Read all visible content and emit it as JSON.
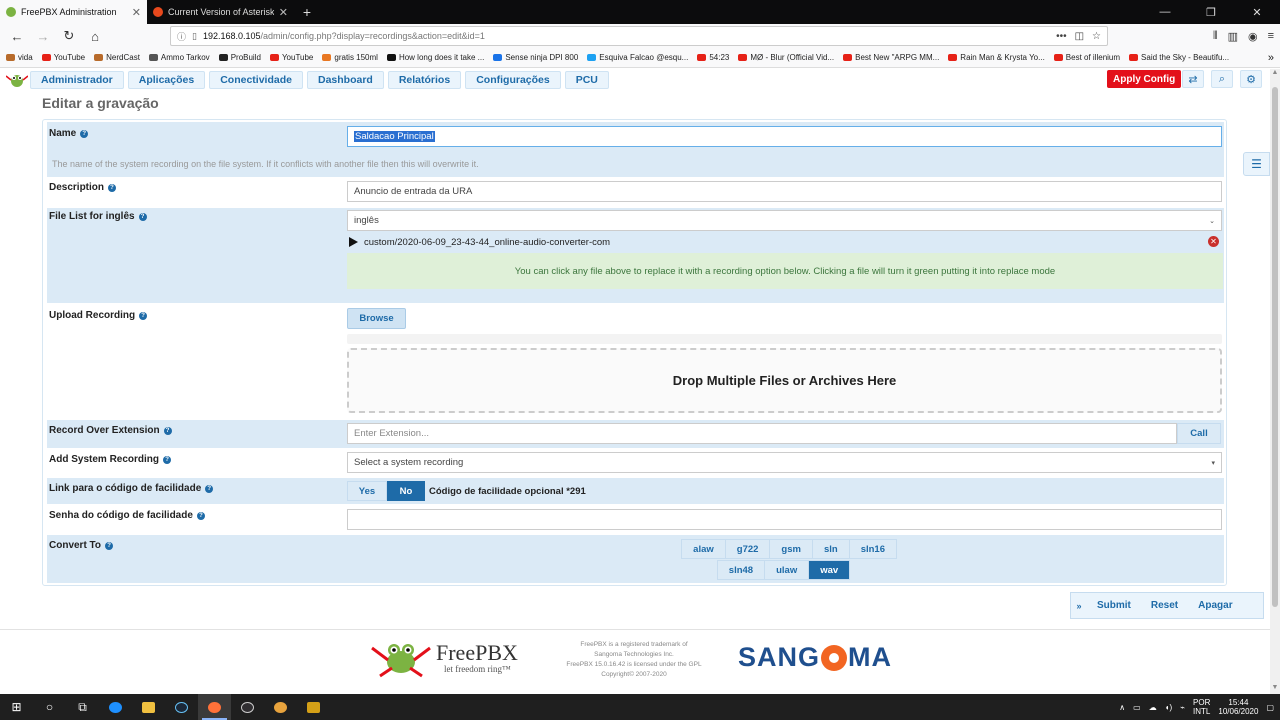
{
  "browser": {
    "tabs": [
      {
        "label": "FreePBX Administration",
        "active": true
      },
      {
        "label": "Current Version of Asterisk and",
        "active": false
      }
    ],
    "url_host": "192.168.0.105",
    "url_path": "/admin/config.php?display=recordings&action=edit&id=1",
    "bookmarks": [
      {
        "label": "vida",
        "color": "#b86b2b"
      },
      {
        "label": "YouTube",
        "color": "#e62117"
      },
      {
        "label": "NerdCast",
        "color": "#b86b2b"
      },
      {
        "label": "Ammo Tarkov",
        "color": "#555555"
      },
      {
        "label": "ProBuild",
        "color": "#222222"
      },
      {
        "label": "YouTube",
        "color": "#e62117"
      },
      {
        "label": "gratis 150ml",
        "color": "#e87722"
      },
      {
        "label": "How long does it take ...",
        "color": "#111111"
      },
      {
        "label": "Sense ninja DPI 800",
        "color": "#1a73e8"
      },
      {
        "label": "Esquiva Falcao @esqu...",
        "color": "#1da1f2"
      },
      {
        "label": "54:23",
        "color": "#e62117"
      },
      {
        "label": "MØ - Blur (Official Vid...",
        "color": "#e62117"
      },
      {
        "label": "Best New \"ARPG MM...",
        "color": "#e62117"
      },
      {
        "label": "Rain Man & Krysta Yo...",
        "color": "#e62117"
      },
      {
        "label": "Best of illenium",
        "color": "#e62117"
      },
      {
        "label": "Said the Sky - Beautifu...",
        "color": "#e62117"
      }
    ]
  },
  "header": {
    "menu": [
      "Administrador",
      "Aplicações",
      "Conectividade",
      "Dashboard",
      "Relatórios",
      "Configurações",
      "PCU"
    ],
    "apply_config": "Apply Config"
  },
  "page": {
    "title": "Editar a gravação"
  },
  "form": {
    "name": {
      "label": "Name",
      "value": "Saldacao Principal",
      "help": "The name of the system recording on the file system. If it conflicts with another file then this will overwrite it."
    },
    "description": {
      "label": "Description",
      "value": "Anuncio de entrada da URA"
    },
    "file_list": {
      "label": "File List for inglês",
      "language": "inglês",
      "file": "custom/2020-06-09_23-43-44_online-audio-converter-com",
      "note": "You can click any file above to replace it with a recording option below. Clicking a file will turn it green putting it into replace mode"
    },
    "upload": {
      "label": "Upload Recording",
      "browse": "Browse",
      "dropzone": "Drop Multiple Files or Archives Here"
    },
    "record_over_extension": {
      "label": "Record Over Extension",
      "placeholder": "Enter Extension...",
      "call": "Call"
    },
    "add_system_recording": {
      "label": "Add System Recording",
      "placeholder": "Select a system recording"
    },
    "feature_code_link": {
      "label": "Link para o código de facilidade",
      "yes": "Yes",
      "no": "No",
      "selected": "No",
      "code_label": "Código de facilidade opcional *291"
    },
    "feature_code_password": {
      "label": "Senha do código de facilidade",
      "value": ""
    },
    "convert_to": {
      "label": "Convert To",
      "row1": [
        "alaw",
        "g722",
        "gsm",
        "sln",
        "sln16"
      ],
      "row2": [
        "sln48",
        "ulaw",
        "wav"
      ],
      "selected": [
        "wav"
      ]
    }
  },
  "actions": {
    "submit": "Submit",
    "reset": "Reset",
    "delete": "Apagar"
  },
  "footer": {
    "brand": "FreePBX",
    "tagline": "let freedom ring™",
    "legal": [
      "FreePBX is a registered trademark of",
      "Sangoma Technologies Inc.",
      "FreePBX 15.0.16.42 is licensed under the GPL",
      "Copyright© 2007-2020"
    ],
    "sangoma_left": "SANG",
    "sangoma_right": "MA"
  },
  "taskbar": {
    "language": [
      "POR",
      "INTL"
    ],
    "time": "15:44",
    "date": "10/06/2020"
  }
}
